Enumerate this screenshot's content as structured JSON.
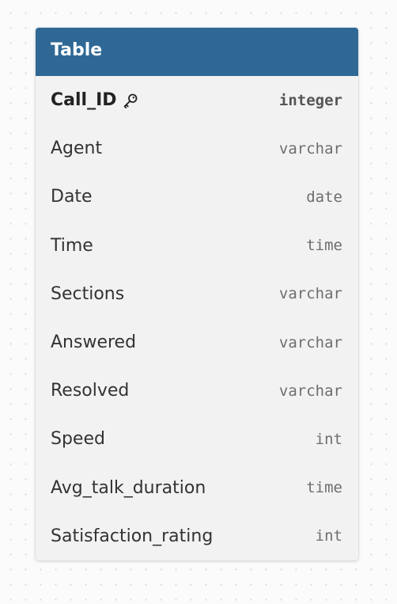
{
  "table": {
    "title": "Table",
    "fields": [
      {
        "name": "Call_ID",
        "type": "integer",
        "primary_key": true
      },
      {
        "name": "Agent",
        "type": "varchar",
        "primary_key": false
      },
      {
        "name": "Date",
        "type": "date",
        "primary_key": false
      },
      {
        "name": "Time",
        "type": "time",
        "primary_key": false
      },
      {
        "name": "Sections",
        "type": "varchar",
        "primary_key": false
      },
      {
        "name": "Answered",
        "type": "varchar",
        "primary_key": false
      },
      {
        "name": "Resolved",
        "type": "varchar",
        "primary_key": false
      },
      {
        "name": "Speed",
        "type": "int",
        "primary_key": false
      },
      {
        "name": "Avg_talk_duration",
        "type": "time",
        "primary_key": false
      },
      {
        "name": "Satisfaction_rating",
        "type": "int",
        "primary_key": false
      }
    ]
  },
  "colors": {
    "header_background": "#2f6895",
    "header_text": "#ffffff",
    "body_background": "#f2f2f2",
    "canvas_background": "#fbfbfb"
  },
  "icons": {
    "primary_key": "key-icon"
  }
}
